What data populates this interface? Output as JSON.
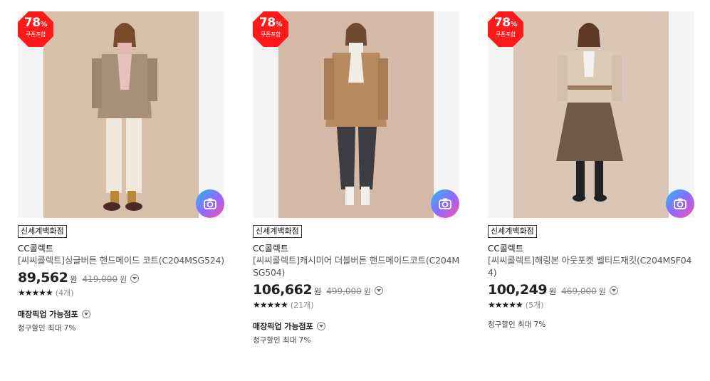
{
  "colors": {
    "badge": "#ff1a1a",
    "camera_gradient": [
      "#28b9f2",
      "#8b6bff",
      "#ff4fa8"
    ]
  },
  "products": [
    {
      "badge_percent": "78",
      "badge_unit": "%",
      "badge_note": "쿠폰포함",
      "store": "신세계백화점",
      "brand": "CC콜렉트",
      "name": "[씨씨콜렉트]싱글버튼 핸드메이드 코트(C204MSG524)",
      "price": "89,562",
      "price_unit": "원",
      "original_price": "419,000",
      "original_unit": "원",
      "stars": "★★★★★",
      "rating": 4.5,
      "review_count": "(4개)",
      "pickup_label": "매장픽업 가능점포",
      "discount_info": "청구할인 최대 7%",
      "image_icon": "camera-icon"
    },
    {
      "badge_percent": "78",
      "badge_unit": "%",
      "badge_note": "쿠폰포함",
      "store": "신세계백화점",
      "brand": "CC콜렉트",
      "name": "[씨씨콜렉트]캐시미어 더블버튼 핸드메이드코트(C204MSG504)",
      "price": "106,662",
      "price_unit": "원",
      "original_price": "499,000",
      "original_unit": "원",
      "stars": "★★★★★",
      "rating": 4.5,
      "review_count": "(21개)",
      "pickup_label": "매장픽업 가능점포",
      "discount_info": "청구할인 최대 7%",
      "image_icon": "camera-icon"
    },
    {
      "badge_percent": "78",
      "badge_unit": "%",
      "badge_note": "쿠폰포함",
      "store": "신세계백화점",
      "brand": "CC콜렉트",
      "name": "[씨씨콜렉트]해링본 아웃포켓 벨티드재킷(C204MSF044)",
      "price": "100,249",
      "price_unit": "원",
      "original_price": "469,000",
      "original_unit": "원",
      "stars": "★★★★★",
      "rating": 5,
      "review_count": "(5개)",
      "discount_info": "청구할인 최대 7%",
      "image_icon": "camera-icon"
    }
  ]
}
